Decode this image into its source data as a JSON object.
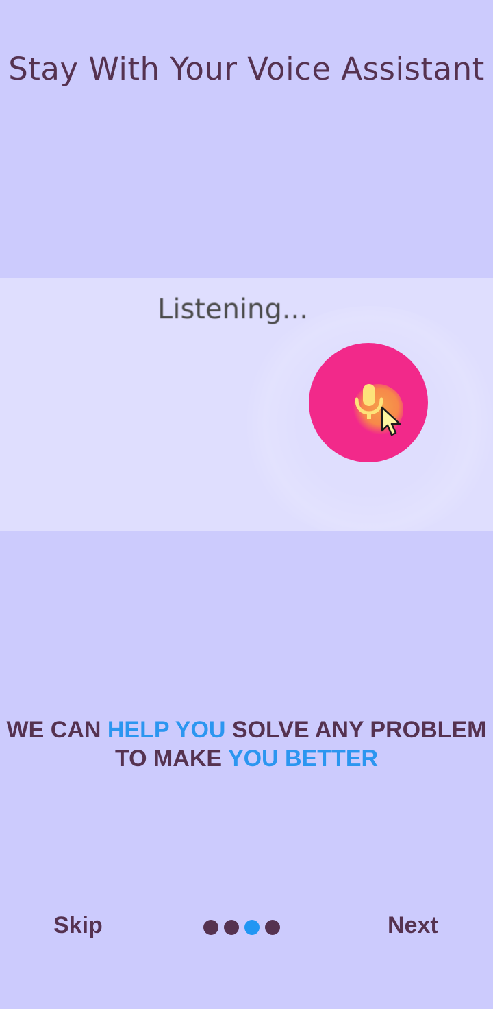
{
  "title": "Stay With Your Voice Assistant",
  "hero": {
    "status_text": "Listening..."
  },
  "tagline": {
    "line1_part1": "WE CAN ",
    "line1_highlight": "HELP YOU",
    "line1_part2": " SOLVE ANY PROBLEM",
    "line2_part1": "TO MAKE ",
    "line2_highlight": "YOU BETTER"
  },
  "footer": {
    "skip_label": "Skip",
    "next_label": "Next",
    "page_count": 4,
    "active_page": 3
  },
  "colors": {
    "background": "#cccbfd",
    "hero_panel": "#dfdefe",
    "text": "#553250",
    "highlight": "#2b96f0",
    "mic_button": "#f2298a",
    "active_dot": "#2196f3"
  },
  "icons": [
    "microphone-icon",
    "cursor-icon"
  ]
}
